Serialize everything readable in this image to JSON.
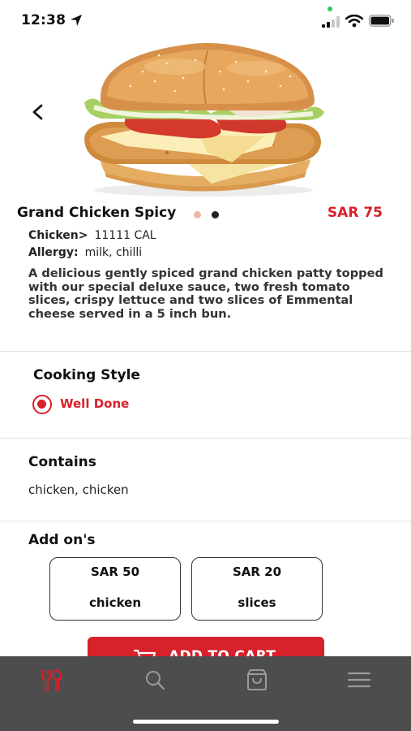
{
  "status_bar": {
    "time": "12:38"
  },
  "product": {
    "name": "Grand Chicken Spicy",
    "price": "SAR 75",
    "calories_label": "Chicken>",
    "calories_value": "11111 CAL",
    "allergy_label": "Allergy:",
    "allergy_value": "milk, chilli",
    "description": "A delicious gently spiced grand chicken patty topped with our special deluxe sauce, two fresh tomato slices, crispy lettuce and two slices of Emmental cheese served in a 5 inch bun."
  },
  "cooking_style": {
    "title": "Cooking Style",
    "selected_option": "Well Done"
  },
  "contains": {
    "title": "Contains",
    "value": "chicken, chicken"
  },
  "addons": {
    "title": "Add on's",
    "items": [
      {
        "price": "SAR 50",
        "name": "chicken"
      },
      {
        "price": "SAR 20",
        "name": "slices"
      }
    ]
  },
  "cart": {
    "button_label": "ADD TO CART"
  },
  "bottom_nav": {
    "items": [
      {
        "icon": "utensils-icon",
        "active": true
      },
      {
        "icon": "search-icon",
        "active": false
      },
      {
        "icon": "bag-icon",
        "active": false
      },
      {
        "icon": "menu-icon",
        "active": false
      }
    ]
  },
  "colors": {
    "accent": "#d7212b",
    "nav_background": "#4d4d4d"
  }
}
